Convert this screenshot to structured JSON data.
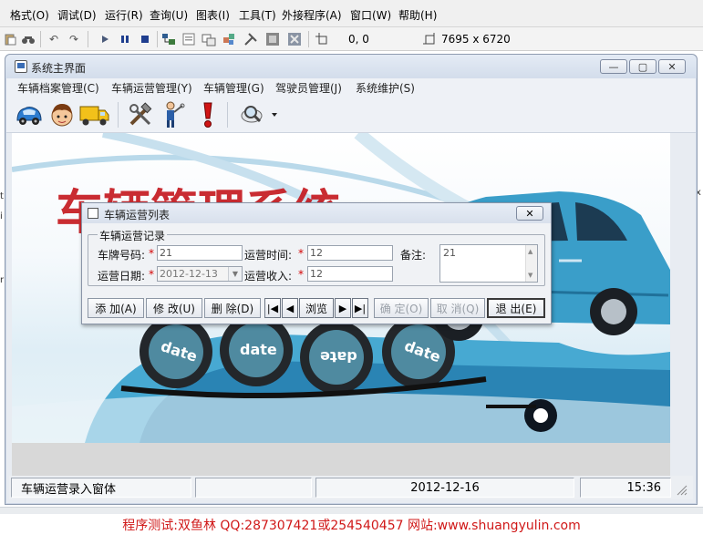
{
  "ide": {
    "menu": [
      "格式(O)",
      "调试(D)",
      "运行(R)",
      "查询(U)",
      "图表(I)",
      "工具(T)",
      "外接程序(A)",
      "窗口(W)",
      "帮助(H)"
    ],
    "coord": "0, 0",
    "size": "7695 x 6720"
  },
  "main": {
    "title": "系统主界面",
    "minimize": "—",
    "maximize": "▢",
    "close": "✕",
    "menu": [
      "车辆档案管理(C)",
      "车辆运营管理(Y)",
      "车辆管理(G)",
      "驾驶员管理(J)",
      "系统维护(S)"
    ],
    "toolbar_icons": [
      "car-icon",
      "driver-avatar-icon",
      "truck-icon",
      "tools-icon",
      "worker-icon",
      "warning-icon",
      "magnifier-icon"
    ]
  },
  "banner": {
    "date_badges": [
      "date",
      "date",
      "date",
      "date"
    ],
    "accent_red": "#c4161c",
    "accent_blue": "#3a9ec9"
  },
  "dialog": {
    "title": "车辆运营列表",
    "close": "✕",
    "group_label": "车辆运营记录",
    "fields": {
      "plate_label": "车牌号码:",
      "plate_value": "21",
      "date_label": "运营日期:",
      "date_value": "2012-12-13",
      "time_label": "运营时间:",
      "time_value": "12",
      "income_label": "运营收入:",
      "income_value": "12",
      "remark_label": "备注:",
      "remark_value": "21",
      "required_mark": "*"
    },
    "buttons": {
      "add": "添 加(A)",
      "edit": "修 改(U)",
      "delete": "删 除(D)",
      "first": "|◀",
      "prev": "◀",
      "browse": "浏览",
      "next": "▶",
      "last": "▶|",
      "confirm": "确 定(O)",
      "cancel": "取 消(Q)",
      "exit": "退 出(E)"
    }
  },
  "status": {
    "message": "车辆运营录入窗体",
    "date": "2012-12-16",
    "time": "15:36"
  },
  "credit": "程序测试:双鱼林 QQ:287307421或254540457 网站:www.shuangyulin.com"
}
